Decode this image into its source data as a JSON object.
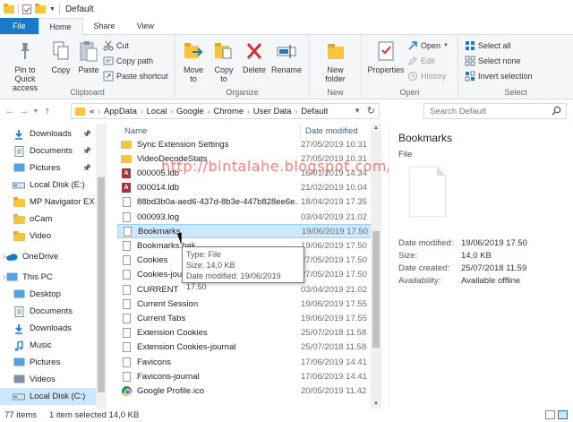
{
  "window": {
    "title": "Default"
  },
  "ribbon_tabs": [
    {
      "label": "File"
    },
    {
      "label": "Home"
    },
    {
      "label": "Share"
    },
    {
      "label": "View"
    }
  ],
  "ribbon": {
    "clipboard": {
      "label": "Clipboard",
      "pin": "Pin to Quick access",
      "copy": "Copy",
      "paste": "Paste",
      "cut": "Cut",
      "copy_path": "Copy path",
      "paste_shortcut": "Paste shortcut"
    },
    "organize": {
      "label": "Organize",
      "move_to": "Move to",
      "copy_to": "Copy to",
      "delete": "Delete",
      "rename": "Rename"
    },
    "new": {
      "label": "New",
      "new_folder": "New folder"
    },
    "open": {
      "label": "Open",
      "properties": "Properties",
      "open": "Open",
      "edit": "Edit",
      "history": "History"
    },
    "select": {
      "label": "Select",
      "select_all": "Select all",
      "select_none": "Select none",
      "invert": "Invert selection"
    }
  },
  "address": {
    "crumbs": [
      "«",
      "AppData",
      "Local",
      "Google",
      "Chrome",
      "User Data",
      "Default"
    ]
  },
  "search": {
    "placeholder": "Search Default"
  },
  "nav": [
    {
      "label": "Downloads",
      "icon": "download-arrow-icon",
      "pinned": true
    },
    {
      "label": "Documents",
      "icon": "documents-icon",
      "pinned": true
    },
    {
      "label": "Pictures",
      "icon": "pictures-icon",
      "pinned": true
    },
    {
      "label": "Local Disk (E:)",
      "icon": "drive-icon",
      "pinned": false
    },
    {
      "label": "MP Navigator EX",
      "icon": "folder-icon",
      "pinned": false
    },
    {
      "label": "oCam",
      "icon": "folder-icon",
      "pinned": false
    },
    {
      "label": "Video",
      "icon": "folder-icon",
      "pinned": false
    },
    {
      "label": "OneDrive",
      "icon": "cloud-icon",
      "pinned": false
    },
    {
      "label": "This PC",
      "icon": "computer-icon",
      "pinned": false
    },
    {
      "label": "Desktop",
      "icon": "desktop-icon",
      "pinned": false
    },
    {
      "label": "Documents",
      "icon": "documents-icon",
      "pinned": false
    },
    {
      "label": "Downloads",
      "icon": "download-arrow-icon",
      "pinned": false
    },
    {
      "label": "Music",
      "icon": "music-icon",
      "pinned": false
    },
    {
      "label": "Pictures",
      "icon": "pictures-icon",
      "pinned": false
    },
    {
      "label": "Videos",
      "icon": "videos-icon",
      "pinned": false
    },
    {
      "label": "Local Disk (C:)",
      "icon": "drive-icon",
      "pinned": false
    }
  ],
  "columns": {
    "name": "Name",
    "date": "Date modified"
  },
  "files": [
    {
      "name": "Sync Extension Settings",
      "date": "27/05/2019 10.31",
      "icon": "folder"
    },
    {
      "name": "VideoDecodeStats",
      "date": "27/05/2019 10.31",
      "icon": "folder"
    },
    {
      "name": "000005.ldb",
      "date": "16/01/2019 14.34",
      "icon": "acc"
    },
    {
      "name": "000014.ldb",
      "date": "21/02/2019 10.04",
      "icon": "acc"
    },
    {
      "name": "88bd3b0a-aed6-437d-8b3e-447b828ee6e...",
      "date": "18/04/2019 17.35",
      "icon": "doc"
    },
    {
      "name": "000093.log",
      "date": "03/04/2019 21.02",
      "icon": "doc"
    },
    {
      "name": "Bookmarks",
      "date": "19/06/2019 17.50",
      "icon": "doc"
    },
    {
      "name": "Bookmarks.bak",
      "date": "19/06/2019 17.50",
      "icon": "doc"
    },
    {
      "name": "Cookies",
      "date": "27/05/2019 17.50",
      "icon": "doc"
    },
    {
      "name": "Cookies-journal",
      "date": "27/05/2019 17.50",
      "icon": "doc"
    },
    {
      "name": "CURRENT",
      "date": "03/04/2019 21.02",
      "icon": "doc"
    },
    {
      "name": "Current Session",
      "date": "19/06/2019 17.55",
      "icon": "doc"
    },
    {
      "name": "Current Tabs",
      "date": "19/06/2019 17.55",
      "icon": "doc"
    },
    {
      "name": "Extension Cookies",
      "date": "25/07/2018 11.58",
      "icon": "doc"
    },
    {
      "name": "Extension Cookies-journal",
      "date": "25/07/2018 11.58",
      "icon": "doc"
    },
    {
      "name": "Favicons",
      "date": "17/06/2019 14.41",
      "icon": "doc"
    },
    {
      "name": "Favicons-journal",
      "date": "17/06/2019 14.41",
      "icon": "doc"
    },
    {
      "name": "Google Profile.ico",
      "date": "20/05/2019 11.42",
      "icon": "chrome"
    }
  ],
  "tooltip": {
    "type": "Type: File",
    "size": "Size: 14,0 KB",
    "date": "Date modified: 19/06/2019 17.50"
  },
  "watermark": "http://bintalahe.blogspot.com/",
  "details": {
    "title": "Bookmarks",
    "type": "File",
    "rows": [
      {
        "k": "Date modified:",
        "v": "19/06/2019 17.50"
      },
      {
        "k": "Size:",
        "v": "14,0 KB"
      },
      {
        "k": "Date created:",
        "v": "25/07/2018 11.59"
      },
      {
        "k": "Availability:",
        "v": "Available offline"
      }
    ]
  },
  "status": {
    "count": "77 items",
    "selection": "1 item selected  14,0 KB"
  },
  "colors": {
    "accent": "#1979ca",
    "selection": "#cce8ff",
    "folder": "#f5c542"
  }
}
